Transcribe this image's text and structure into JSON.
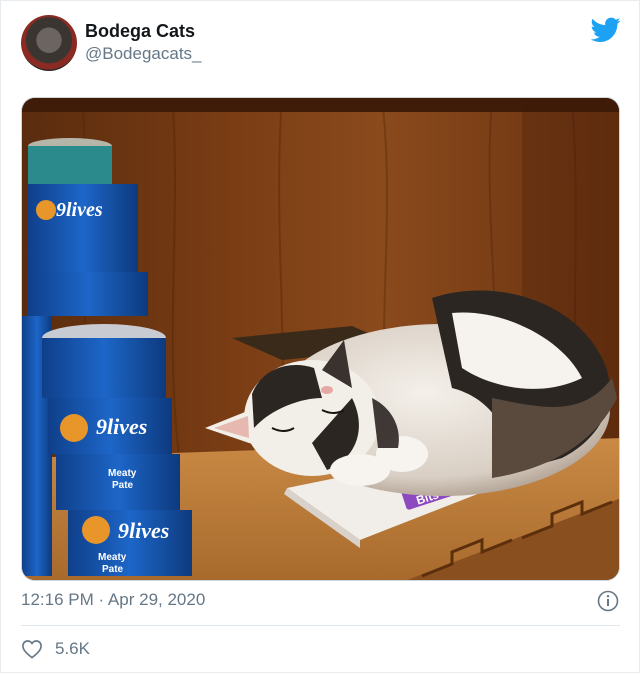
{
  "tweet": {
    "display_name": "Bodega Cats",
    "handle": "@Bodegacats_",
    "timestamp": "12:16 PM · Apr 29, 2020",
    "likes": "5.6K"
  },
  "photo": {
    "can_brand": "9lives",
    "can_label_1": "Meaty",
    "can_label_2": "Pate",
    "box_label": "Bits"
  },
  "icons": {
    "brand": "twitter-bird-icon",
    "info": "info-icon",
    "like": "heart-icon"
  },
  "colors": {
    "twitter_blue": "#1da1f2",
    "secondary_text": "#657786"
  }
}
